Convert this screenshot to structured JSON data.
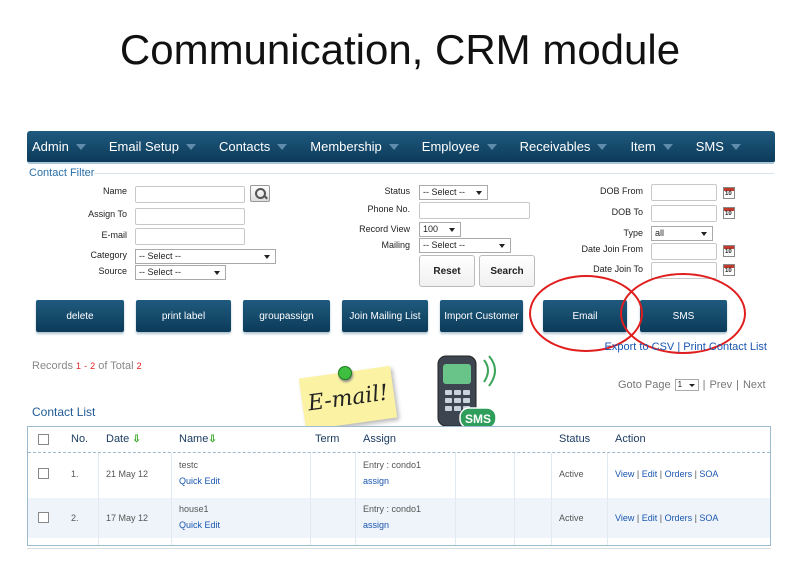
{
  "slide_title": "Communication, CRM module",
  "nav": [
    "Admin",
    "Email Setup",
    "Contacts",
    "Membership",
    "Employee",
    "Receivables",
    "Item",
    "SMS"
  ],
  "filter": {
    "legend": "Contact Filter",
    "name_label": "Name",
    "assign_to_label": "Assign To",
    "email_label": "E-mail",
    "category_label": "Category",
    "category_value": "-- Select --",
    "source_label": "Source",
    "source_value": "-- Select --",
    "status_label": "Status",
    "status_value": "-- Select --",
    "phone_label": "Phone No.",
    "record_view_label": "Record View",
    "record_view_value": "100",
    "mailing_label": "Mailing",
    "mailing_value": "-- Select --",
    "dob_from_label": "DOB From",
    "dob_to_label": "DOB To",
    "type_label": "Type",
    "type_value": "all",
    "date_join_from_label": "Date Join From",
    "date_join_to_label": "Date Join To",
    "calendar_day": "10",
    "reset_label": "Reset",
    "search_label": "Search"
  },
  "actions": [
    "delete",
    "print label",
    "groupassign",
    "Join Mailing List",
    "Import Customer",
    "Email",
    "SMS"
  ],
  "links": {
    "export": "Export to CSV",
    "separator": "|",
    "print": "Print Contact List"
  },
  "records": {
    "prefix": "Records",
    "from": "1",
    "dash": "-",
    "to": "2",
    "of_total": "of Total",
    "total": "2"
  },
  "pagination": {
    "goto_label": "Goto Page",
    "page": "1",
    "prev": "Prev",
    "next": "Next",
    "separator": "|"
  },
  "sticker_text": "E-mail!",
  "sms_badge": "SMS",
  "list": {
    "title": "Contact List",
    "headers": [
      "No.",
      "Date",
      "Name",
      "Term",
      "Assign",
      "Status",
      "Action"
    ],
    "rows": [
      {
        "no": "1.",
        "date": "21 May 12",
        "name": "testc",
        "quick_edit": "Quick Edit",
        "entry": "Entry : condo1",
        "assign": "assign",
        "status": "Active",
        "actions": [
          "View",
          "Edit",
          "Orders",
          "SOA"
        ]
      },
      {
        "no": "2.",
        "date": "17 May 12",
        "name": "house1",
        "quick_edit": "Quick Edit",
        "entry": "Entry : condo1",
        "assign": "assign",
        "status": "Active",
        "actions": [
          "View",
          "Edit",
          "Orders",
          "SOA"
        ]
      }
    ]
  },
  "colors": {
    "nav_bg": "#0c3b5a",
    "highlight_ring": "#e01e1e",
    "link": "#1a56b0"
  }
}
